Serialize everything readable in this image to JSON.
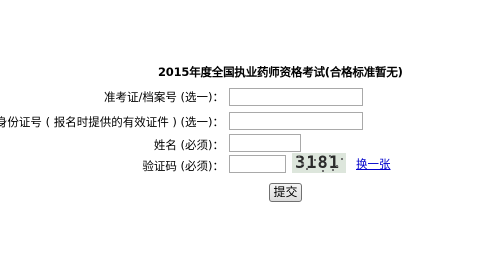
{
  "form": {
    "title": "2015年度全国执业药师资格考试(合格标准暂无)",
    "fields": [
      {
        "label": "准考证/档案号 (选一)：",
        "value": ""
      },
      {
        "label": "或身份证号 ( 报名时提供的有效证件 ) (选一)：",
        "value": ""
      },
      {
        "label": "姓名 (必须)：",
        "value": ""
      },
      {
        "label": "验证码 (必须)：",
        "value": ""
      }
    ],
    "captcha_text": "3181",
    "refresh_label": "换一张",
    "submit_label": "提交"
  }
}
